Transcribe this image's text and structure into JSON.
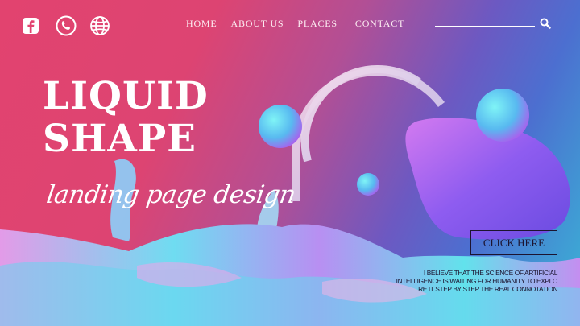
{
  "nav": {
    "items": [
      "HOME",
      "ABOUT US",
      "PLACES",
      "CONTACT"
    ]
  },
  "social": {
    "icons": [
      "facebook-icon",
      "phone-icon",
      "globe-icon"
    ]
  },
  "search": {
    "icon": "search-icon"
  },
  "hero": {
    "title_line1": "LIQUID",
    "title_line2": "SHAPE",
    "subtitle": "landing page design",
    "cta_label": "CLICK HERE",
    "quote_line1": "I BELIEVE THAT THE SCIENCE OF ARTIFICIAL",
    "quote_line2": "INTELLIGENCE IS WAITING FOR HUMANITY TO EXPLO",
    "quote_line3": "RE IT STEP BY STEP THE REAL CONNOTATION"
  },
  "colors": {
    "background_left": "#e2436f",
    "background_right": "#39b6d6",
    "text_light": "#ffffff",
    "text_dark": "#1c1430",
    "blob_cyan": "#4fe0f0",
    "blob_violet": "#a060f0"
  }
}
